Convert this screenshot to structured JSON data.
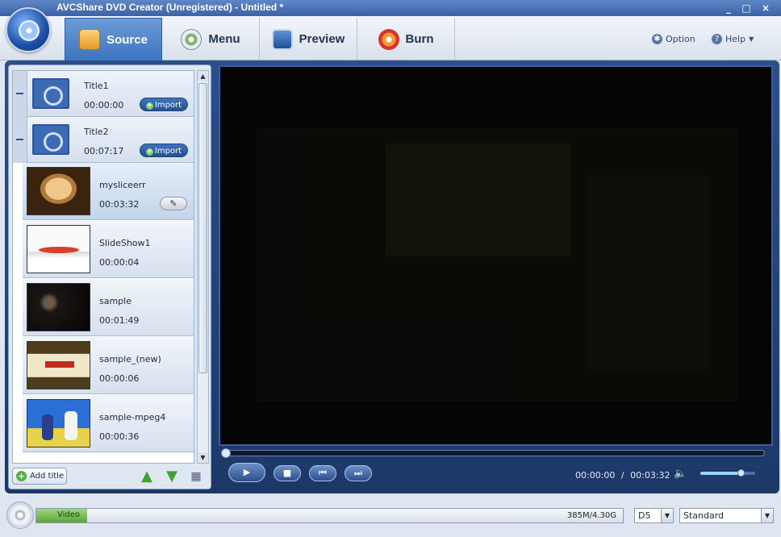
{
  "window": {
    "title": "AVCShare DVD Creator (Unregistered) - Untitled *",
    "controls": [
      "_",
      "□",
      "×"
    ]
  },
  "tabs": [
    {
      "label": "Source",
      "icon": "download-arrow-icon",
      "active": true
    },
    {
      "label": "Menu",
      "icon": "disc-icon"
    },
    {
      "label": "Preview",
      "icon": "monitor-icon"
    },
    {
      "label": "Burn",
      "icon": "burn-disc-icon"
    }
  ],
  "toolbar_right": {
    "option": "Option",
    "help": "Help"
  },
  "titles": [
    {
      "name": "Title1",
      "duration": "00:00:00",
      "import": "Import"
    },
    {
      "name": "Title2",
      "duration": "00:07:17",
      "import": "Import"
    }
  ],
  "clips": [
    {
      "name": "mysliceerr",
      "duration": "00:03:32",
      "selected": true
    },
    {
      "name": "SlideShow1",
      "duration": "00:00:04"
    },
    {
      "name": "sample",
      "duration": "00:01:49"
    },
    {
      "name": "sample_(new)",
      "duration": "00:00:06"
    },
    {
      "name": "sample-mpeg4",
      "duration": "00:00:36"
    }
  ],
  "left_bottom": {
    "add_title": "Add title"
  },
  "player": {
    "current_time": "00:00:00",
    "separator": "/",
    "total_time": "00:03:32",
    "volume_level": 0.75
  },
  "status": {
    "capacity_label": "Video",
    "capacity_text": "385M/4.30G",
    "capacity_fraction": 0.087,
    "disc_type": "D5",
    "quality": "Standard"
  },
  "colors": {
    "accent": "#3e74c0",
    "frame": "#1c3868",
    "progress": "#5aa63a"
  }
}
